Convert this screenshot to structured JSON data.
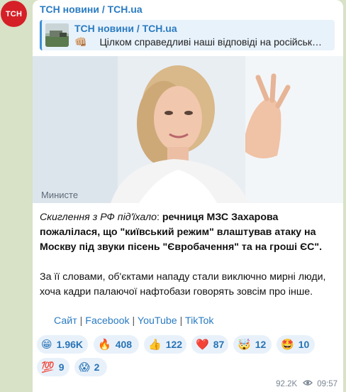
{
  "avatar": {
    "label": "ТСН",
    "color": "#d52027"
  },
  "message": {
    "channel": "ТСН новини / TCH.ua",
    "reply": {
      "channel": "ТСН новини / TCH.ua",
      "emoji": "👊🏼",
      "text": "Цілком справедливі наші відповіді на російськ…"
    },
    "text": {
      "italic": "Скиглення з РФ під'їхало",
      "colon": ": ",
      "bold_lead": "речниця МЗС Захарова пожалілася, що \"київський режим\" влаштував атаку на Москву під звуки пісень \"Євробачення\" та на гроші ЄС\".",
      "paragraph2": "За її словами, об'єктами нападу стали виключно мирні люди, хоча кадри палаючої нафтобази говорять зовсім про інше."
    },
    "links": [
      {
        "label": "Сайт"
      },
      {
        "label": "Facebook"
      },
      {
        "label": "YouTube"
      },
      {
        "label": "TikTok"
      }
    ],
    "link_separator": " | ",
    "reactions": [
      {
        "emoji": "😁",
        "count": "1.96K"
      },
      {
        "emoji": "🔥",
        "count": "408"
      },
      {
        "emoji": "👍",
        "count": "122"
      },
      {
        "emoji": "❤️",
        "count": "87"
      },
      {
        "emoji": "🤯",
        "count": "12"
      },
      {
        "emoji": "🤩",
        "count": "10"
      },
      {
        "emoji": "💯",
        "count": "9"
      },
      {
        "emoji": "😱",
        "count": "2"
      }
    ],
    "views": "92.2K",
    "time": "09:57",
    "photo_caption_fragment": "Министе"
  },
  "colors": {
    "link": "#2a7bc1",
    "reaction_bg": "#e8f1fa",
    "chat_bg": "#d7e2c6"
  }
}
